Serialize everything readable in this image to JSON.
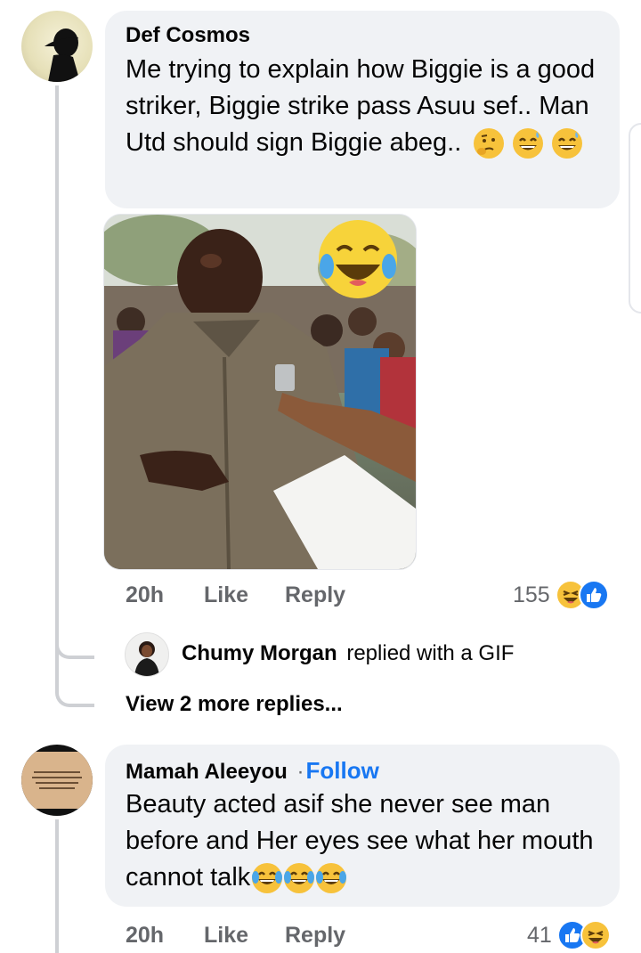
{
  "comment1": {
    "author": "Def Cosmos",
    "text": "Me trying to explain how Biggie is a good striker, Biggie strike pass Asuu sef.. Man Utd should sign Biggie abeg..",
    "emojis": [
      "thinking-face",
      "grinning-sweat",
      "grinning-sweat"
    ],
    "time": "20h",
    "like_label": "Like",
    "reply_label": "Reply",
    "reaction_count": "155",
    "reaction_icons": [
      "laugh-reaction",
      "like-reaction"
    ]
  },
  "reply": {
    "author": "Chumy Morgan",
    "action_text": "replied with a GIF"
  },
  "view_more": "View 2 more replies...",
  "comment2": {
    "author": "Mamah Aleeyou",
    "separator": "·",
    "follow_label": "Follow",
    "text": "Beauty acted asif she never see man before and Her eyes see what her mouth cannot talk",
    "emojis": [
      "tears-of-joy",
      "tears-of-joy",
      "tears-of-joy"
    ],
    "time": "20h",
    "like_label": "Like",
    "reply_label": "Reply",
    "reaction_count": "41",
    "reaction_icons": [
      "like-reaction",
      "laugh-reaction"
    ]
  },
  "colors": {
    "bubble": "#f0f2f5",
    "meta": "#65676b",
    "link": "#1877f2",
    "thread_line": "#ced0d4"
  }
}
